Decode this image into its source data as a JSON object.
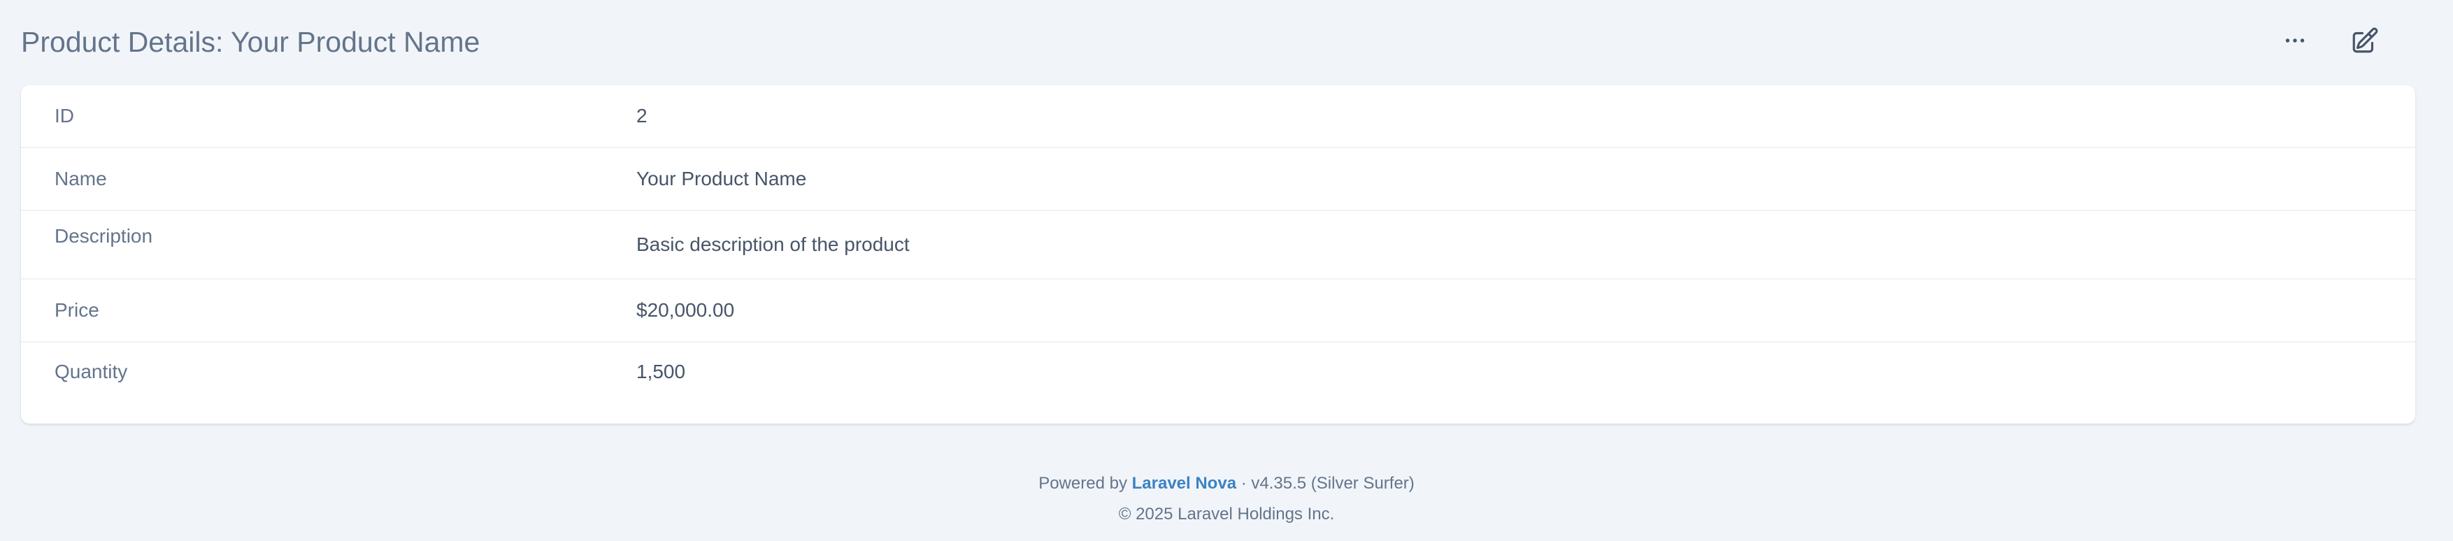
{
  "header": {
    "title": "Product Details: Your Product Name",
    "actions": [
      {
        "icon": "ellipsis-horizontal-icon"
      },
      {
        "icon": "pencil-square-icon"
      }
    ]
  },
  "details": {
    "rows": [
      {
        "label": "ID",
        "value": "2"
      },
      {
        "label": "Name",
        "value": "Your Product Name"
      },
      {
        "label": "Description",
        "value": "Basic description of the product"
      },
      {
        "label": "Price",
        "value": "$20,000.00"
      },
      {
        "label": "Quantity",
        "value": "1,500"
      }
    ]
  },
  "footer": {
    "powered_by": "Powered by",
    "link_text": "Laravel Nova",
    "version": "· v4.35.5 (Silver Surfer)",
    "copyright": "© 2025 Laravel Holdings Inc."
  },
  "colors": {
    "background": "#f1f5f9",
    "card": "#ffffff",
    "link": "#3b82c4",
    "text": "#475569"
  }
}
